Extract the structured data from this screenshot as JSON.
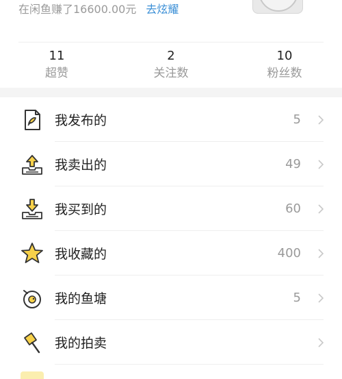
{
  "earnings": {
    "text": "在闲鱼赚了16600.00元",
    "brag_link": "去炫耀"
  },
  "stats": [
    {
      "value": "11",
      "label": "超赞"
    },
    {
      "value": "2",
      "label": "关注数"
    },
    {
      "value": "10",
      "label": "粉丝数"
    }
  ],
  "menu": [
    {
      "label": "我发布的",
      "count": "5",
      "icon": "published-icon"
    },
    {
      "label": "我卖出的",
      "count": "49",
      "icon": "sold-icon"
    },
    {
      "label": "我买到的",
      "count": "60",
      "icon": "bought-icon"
    },
    {
      "label": "我收藏的",
      "count": "400",
      "icon": "star-icon"
    },
    {
      "label": "我的鱼塘",
      "count": "5",
      "icon": "fish-pond-icon"
    },
    {
      "label": "我的拍卖",
      "count": "",
      "icon": "auction-hammer-icon"
    }
  ],
  "colors": {
    "accent_link": "#3b8fd6",
    "icon_yellow": "#f7d14a",
    "icon_stroke": "#333333"
  }
}
